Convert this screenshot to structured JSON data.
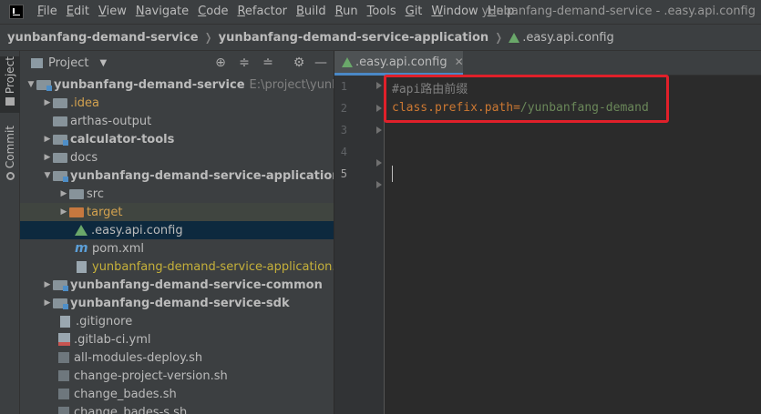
{
  "menu": {
    "items": [
      {
        "mnemonic": "F",
        "rest": "ile"
      },
      {
        "mnemonic": "E",
        "rest": "dit"
      },
      {
        "mnemonic": "V",
        "rest": "iew"
      },
      {
        "mnemonic": "N",
        "rest": "avigate"
      },
      {
        "mnemonic": "C",
        "rest": "ode"
      },
      {
        "mnemonic": "R",
        "rest": "efactor"
      },
      {
        "mnemonic": "B",
        "rest": "uild"
      },
      {
        "mnemonic": "R",
        "rest": "un"
      },
      {
        "mnemonic": "T",
        "rest": "ools"
      },
      {
        "mnemonic": "G",
        "rest": "it"
      },
      {
        "mnemonic": "W",
        "rest": "indow"
      },
      {
        "mnemonic": "H",
        "rest": "elp"
      }
    ],
    "window_title": "yunbanfang-demand-service - .easy.api.config"
  },
  "breadcrumb": {
    "items": [
      "yunbanfang-demand-service",
      "yunbanfang-demand-service-application",
      ".easy.api.config"
    ]
  },
  "tool_strip": {
    "project_label": "Project",
    "commit_label": "Commit"
  },
  "project_panel": {
    "title": "Project",
    "tree": [
      {
        "label": "yunbanfang-demand-service",
        "path": "E:\\project\\yunbanfan",
        "expanded": true
      },
      {
        "label": ".idea"
      },
      {
        "label": "arthas-output"
      },
      {
        "label": "calculator-tools"
      },
      {
        "label": "docs"
      },
      {
        "label": "yunbanfang-demand-service-application",
        "expanded": true
      },
      {
        "label": "src"
      },
      {
        "label": "target"
      },
      {
        "label": ".easy.api.config"
      },
      {
        "label": "pom.xml"
      },
      {
        "label": "yunbanfang-demand-service-application.iml"
      },
      {
        "label": "yunbanfang-demand-service-common"
      },
      {
        "label": "yunbanfang-demand-service-sdk"
      },
      {
        "label": ".gitignore"
      },
      {
        "label": ".gitlab-ci.yml"
      },
      {
        "label": "all-modules-deploy.sh"
      },
      {
        "label": "change-project-version.sh"
      },
      {
        "label": "change_bades.sh"
      },
      {
        "label": "change_bades-s.sh"
      }
    ]
  },
  "editor": {
    "tab_label": ".easy.api.config",
    "line_numbers": [
      "1",
      "2",
      "3",
      "4",
      "5"
    ],
    "lines": {
      "comment": "#api路由前缀",
      "key": "class.prefix.path",
      "eq": "=",
      "value": "/yunbanfang-demand"
    }
  },
  "colors": {
    "accent": "#4a88c7",
    "highlight_border": "#e0202a",
    "key": "#cc7832",
    "value": "#6a8759"
  }
}
